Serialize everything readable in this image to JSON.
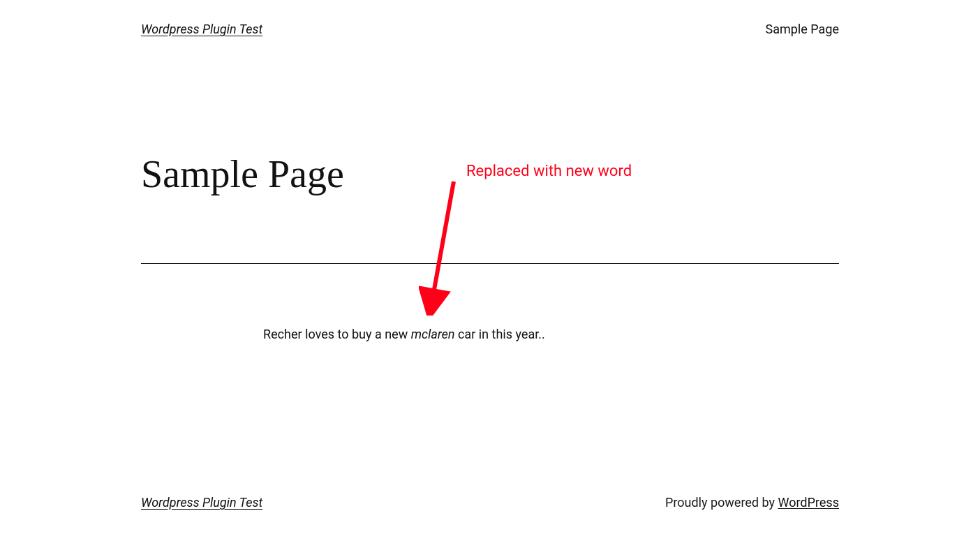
{
  "header": {
    "site_title": "Wordpress Plugin Test",
    "nav": {
      "sample_page": "Sample Page"
    }
  },
  "page": {
    "title": "Sample Page",
    "paragraph_pre": "Recher loves to buy a new ",
    "paragraph_em": "mclaren",
    "paragraph_post": " car in this year.."
  },
  "annotation": {
    "label": "Replaced with new word"
  },
  "footer": {
    "site_title": "Wordpress Plugin Test",
    "powered_pre": "Proudly powered by ",
    "powered_link": "WordPress"
  }
}
